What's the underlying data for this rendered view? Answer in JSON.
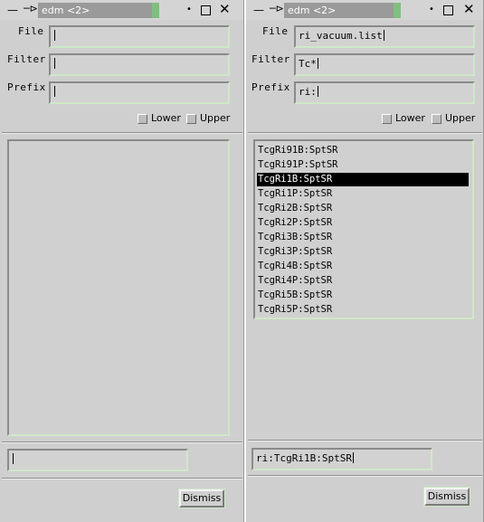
{
  "windows": [
    {
      "title": "edm <2>",
      "labels": {
        "file": "File",
        "filter": "Filter",
        "prefix": "Prefix"
      },
      "fields": {
        "file": "",
        "filter": "",
        "prefix": ""
      },
      "checkboxes": {
        "lower": "Lower",
        "upper": "Upper"
      },
      "list_items": [],
      "selected_index": -1,
      "selection_value": "",
      "dismiss_label": "Dismiss"
    },
    {
      "title": "edm <2>",
      "labels": {
        "file": "File",
        "filter": "Filter",
        "prefix": "Prefix"
      },
      "fields": {
        "file": "ri_vacuum.list",
        "filter": "Tc*",
        "prefix": "ri:"
      },
      "checkboxes": {
        "lower": "Lower",
        "upper": "Upper"
      },
      "list_items": [
        "TcgRi91B:SptSR",
        "TcgRi91P:SptSR",
        "TcgRi1B:SptSR",
        "TcgRi1P:SptSR",
        "TcgRi2B:SptSR",
        "TcgRi2P:SptSR",
        "TcgRi3B:SptSR",
        "TcgRi3P:SptSR",
        "TcgRi4B:SptSR",
        "TcgRi4P:SptSR",
        "TcgRi5B:SptSR",
        "TcgRi5P:SptSR"
      ],
      "selected_index": 2,
      "selection_value": "ri:TcgRi1B:SptSR",
      "dismiss_label": "Dismiss"
    }
  ],
  "colors": {
    "window_bg": "#cfcfcf",
    "title_bg": "#9a9a9a",
    "title_accent": "#7fbf7f",
    "input_highlight": "#cfe8c8",
    "selection_bg": "#000000",
    "selection_fg": "#ffffff"
  },
  "icons": {
    "window_menu": "dash-icon",
    "pin": "pin-icon",
    "minimize": "dot-icon",
    "maximize": "square-icon",
    "close": "x-icon"
  }
}
